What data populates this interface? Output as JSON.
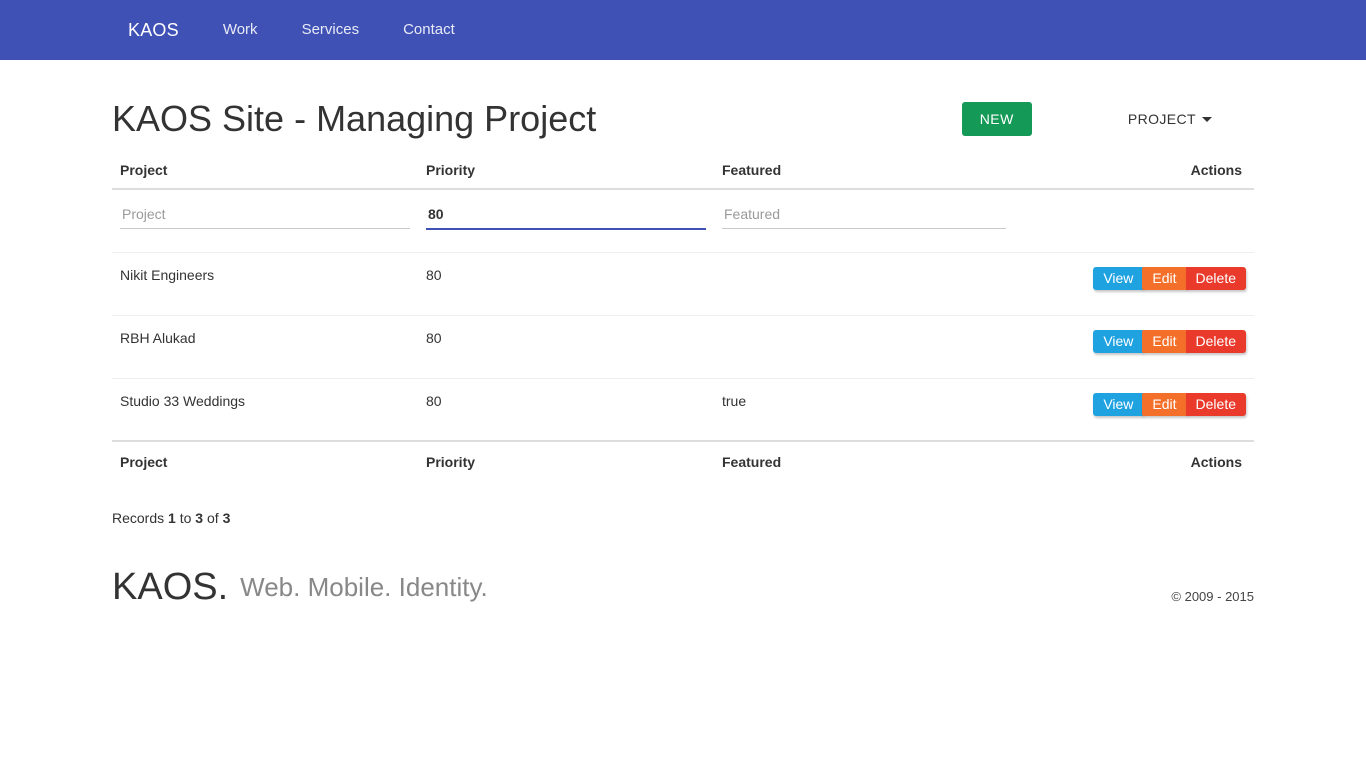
{
  "navbar": {
    "brand": "KAOS",
    "links": [
      {
        "label": "Work"
      },
      {
        "label": "Services"
      },
      {
        "label": "Contact"
      }
    ],
    "background_color": "#3f51b5"
  },
  "header": {
    "title": "KAOS Site - Managing Project",
    "new_button_label": "NEW",
    "new_button_color": "#159957",
    "dropdown_label": "PROJECT",
    "dropdown_icon": "caret-down-icon"
  },
  "table": {
    "columns": [
      "Project",
      "Priority",
      "Featured",
      "Actions"
    ],
    "filters": {
      "project": {
        "value": "",
        "placeholder": "Project",
        "focused": false
      },
      "priority": {
        "value": "80",
        "placeholder": "Priority",
        "focused": true
      },
      "featured": {
        "value": "",
        "placeholder": "Featured",
        "focused": false
      }
    },
    "rows": [
      {
        "project": "Nikit Engineers",
        "priority": "80",
        "featured": ""
      },
      {
        "project": "RBH Alukad",
        "priority": "80",
        "featured": ""
      },
      {
        "project": "Studio 33 Weddings",
        "priority": "80",
        "featured": "true"
      }
    ],
    "actions": {
      "view": "View",
      "edit": "Edit",
      "delete": "Delete",
      "view_color": "#1fa2e0",
      "edit_color": "#f4702a",
      "delete_color": "#ea3a2c"
    }
  },
  "records": {
    "prefix": "Records ",
    "from": "1",
    "mid": " to ",
    "to": "3",
    "suffix": " of ",
    "total": "3"
  },
  "footer": {
    "brand": "KAOS.",
    "tagline": "Web. Mobile. Identity.",
    "copyright": "© 2009 - 2015"
  }
}
